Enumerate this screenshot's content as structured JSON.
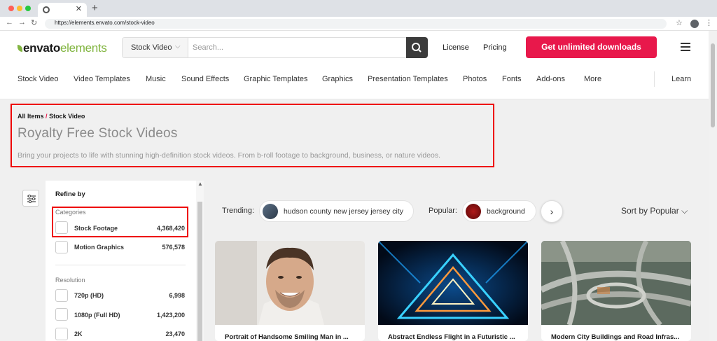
{
  "browser": {
    "url": "https://elements.envato.com/stock-video",
    "dot_colors": [
      "#ff5f57",
      "#febc2e",
      "#28c840"
    ]
  },
  "header": {
    "logo_part1": "envato",
    "logo_part2": "elements",
    "search_type": "Stock Video",
    "search_placeholder": "Search...",
    "link_license": "License",
    "link_pricing": "Pricing",
    "cta": "Get unlimited downloads"
  },
  "categories": [
    "Stock Video",
    "Video Templates",
    "Music",
    "Sound Effects",
    "Graphic Templates",
    "Graphics",
    "Presentation Templates",
    "Photos",
    "Fonts",
    "Add-ons",
    "More",
    "Learn"
  ],
  "hero": {
    "crumb_all": "All Items",
    "crumb_sep": "/",
    "crumb_current": "Stock Video",
    "title": "Royalty Free Stock Videos",
    "description": "Bring your projects to life with stunning high-definition stock videos. From b-roll footage to background, business, or nature videos."
  },
  "sidebar": {
    "title": "Refine by",
    "categories_heading": "Categories",
    "categories": [
      {
        "label": "Stock Footage",
        "count": "4,368,420"
      },
      {
        "label": "Motion Graphics",
        "count": "576,578"
      }
    ],
    "resolution_heading": "Resolution",
    "resolutions": [
      {
        "label": "720p (HD)",
        "count": "6,998"
      },
      {
        "label": "1080p (Full HD)",
        "count": "1,423,200"
      },
      {
        "label": "2K",
        "count": "23,470"
      }
    ]
  },
  "trending": {
    "label": "Trending:",
    "term": "hudson county new jersey jersey city",
    "popular_label": "Popular:",
    "popular_term": "background"
  },
  "sort": {
    "label": "Sort by Popular"
  },
  "cards": [
    {
      "title": "Portrait of Handsome Smiling Man in ..."
    },
    {
      "title": "Abstract Endless Flight in a Futuristic ..."
    },
    {
      "title": "Modern City Buildings and Road Infras..."
    }
  ],
  "colors": {
    "accent": "#e8184b",
    "brand_green": "#82b541",
    "highlight_border": "#e00000"
  }
}
